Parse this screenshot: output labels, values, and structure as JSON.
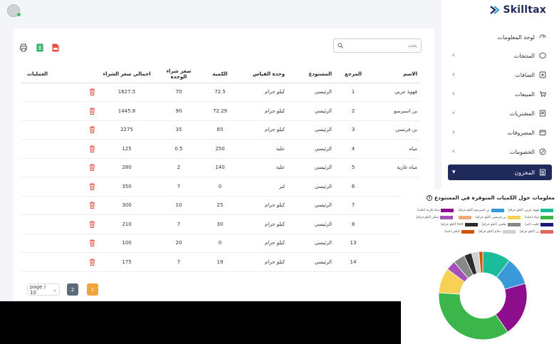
{
  "brand": {
    "name": "Skilltax"
  },
  "sidebar": {
    "items": [
      {
        "label": "لوحة المعلومات",
        "icon": "dashboard-icon",
        "chevron": false
      },
      {
        "label": "المنتجات",
        "icon": "box-icon",
        "chevron": true
      },
      {
        "label": "الضافات",
        "icon": "addons-icon",
        "chevron": true
      },
      {
        "label": "المبيعات",
        "icon": "cart-icon",
        "chevron": true
      },
      {
        "label": "المشتريات",
        "icon": "purchases-icon",
        "chevron": true
      },
      {
        "label": "المصروفات",
        "icon": "expenses-icon",
        "chevron": true
      },
      {
        "label": "الخصومات",
        "icon": "discount-icon",
        "chevron": true
      },
      {
        "label": "المخزون",
        "icon": "inventory-icon",
        "chevron": true,
        "active": true
      }
    ]
  },
  "search": {
    "placeholder": "بحث"
  },
  "table": {
    "headers": [
      "الاسم",
      "المرجع",
      "المستودع",
      "وحدة القياس",
      "الكمية",
      "سعر شراء الوحدة",
      "اجمالي سعر الشراء",
      "العمليات"
    ],
    "rows": [
      [
        "قهوة عربي",
        "1",
        "الرئيسي",
        "كيلو جرام",
        "72.5",
        "70",
        "1627.5"
      ],
      [
        "بن اسبرسو",
        "2",
        "الرئيسي",
        "كيلو جرام",
        "72.29",
        "90",
        "1445.8"
      ],
      [
        "بن فرنسي",
        "3",
        "الرئيسي",
        "كيلو جرام",
        "65",
        "35",
        "2275"
      ],
      [
        "مياه",
        "4",
        "الرئيسي",
        "علبة",
        "250",
        "0.5",
        "125"
      ],
      [
        "مياه غازية",
        "5",
        "الرئيسي",
        "علبة",
        "140",
        "2",
        "280"
      ],
      [
        "",
        "6",
        "الرئيسي",
        "لتر",
        "0",
        "7",
        "350"
      ],
      [
        "",
        "7",
        "الرئيسي",
        "كيلو جرام",
        "25",
        "10",
        "300"
      ],
      [
        "",
        "8",
        "الرئيسي",
        "كيلو جرام",
        "30",
        "7",
        "210"
      ],
      [
        "",
        "13",
        "الرئيسي",
        "كيلو جرام",
        "0",
        "20",
        "100"
      ],
      [
        "",
        "14",
        "الرئيسي",
        "كيلو جرام",
        "19",
        "7",
        "175"
      ]
    ]
  },
  "pager": {
    "page_size": "page / 10",
    "pages": [
      "2",
      "1"
    ]
  },
  "chart_title": "معلومات حول الكميات المتوفرة في المستودع",
  "chart_data": {
    "type": "pie",
    "labels": [
      "قهوة عربي (كيلو جرام)",
      "بن اسبرسو (كيلو جرام)",
      "مياه غازية (علبة)",
      "مياه (علبة)",
      "بن فرنسي (كيلو جرام)",
      "",
      "سكر (كيلو جرام)",
      "حليب (لتر)",
      "طحين (كيلو جرام)",
      "test (كيلو جرام)",
      "رز (كيلو جرام)",
      "دجاج (كيلو جرام)",
      "كيكتر (حبة)"
    ],
    "colors": [
      "#1abc9c",
      "#3a9ad9",
      "#8e0f8e",
      "#3cb54a",
      "#f7d154",
      "#f0a97a",
      "#a54fb8",
      "#1a1a7a",
      "#888888",
      "#2d2d2d",
      "#e0655d",
      "#d0d0d0",
      "#d35400"
    ],
    "values": [
      72.5,
      72.29,
      140,
      250,
      65,
      0,
      25,
      0,
      30,
      20,
      0,
      19,
      10
    ]
  }
}
